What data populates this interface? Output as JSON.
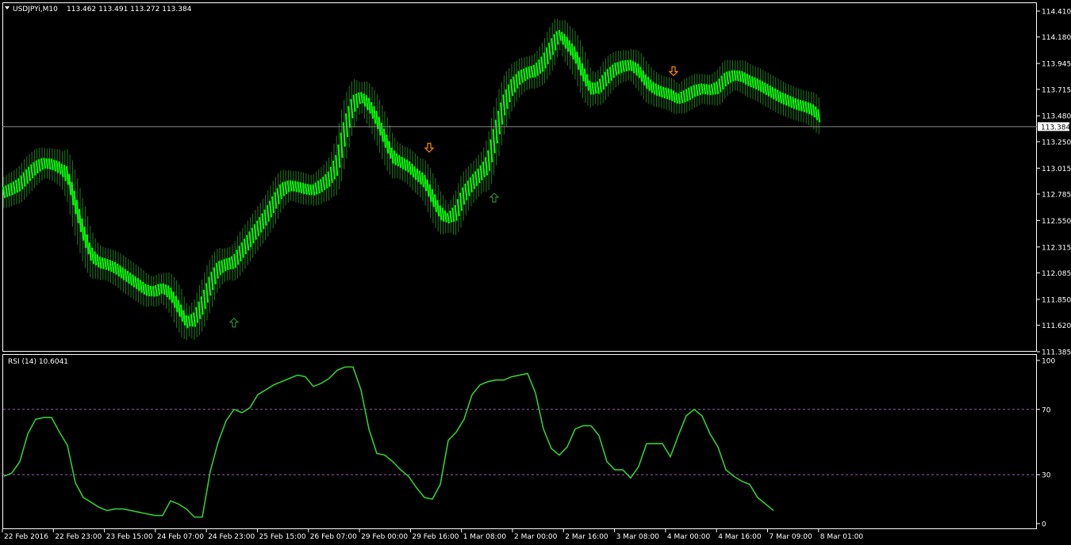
{
  "header": {
    "symbol_label": "USDJPYi,M10",
    "ohlc": "113.462 113.491 113.272 113.384"
  },
  "rsi_header": {
    "label": "RSI (14) 10.6041"
  },
  "colors": {
    "background": "#000000",
    "bars": "#00ff00",
    "bar_outline": "#1c7d1c",
    "rsi_line": "#32cd32",
    "level_line": "#9b59b6",
    "axis": "#ffffff",
    "arrow_up": "#2e8b2e",
    "arrow_down": "#ff8c00"
  },
  "icons": [
    "menu-triangle-icon",
    "up-arrow-icon",
    "down-arrow-icon"
  ],
  "chart_data": [
    {
      "type": "line",
      "name": "price",
      "ylim": [
        111.385,
        114.41
      ],
      "yticks": [
        "114.410",
        "114.180",
        "113.945",
        "113.715",
        "113.480",
        "113.250",
        "113.015",
        "112.785",
        "112.550",
        "112.315",
        "112.085",
        "111.850",
        "111.620",
        "111.385"
      ],
      "current_price": "113.384",
      "current_price_value": 113.384,
      "x": [
        0,
        10,
        20,
        30,
        40,
        50,
        60,
        70,
        80,
        90,
        100,
        110,
        120,
        130,
        140,
        150,
        160,
        170,
        180,
        190,
        200,
        210,
        220,
        230,
        240,
        250,
        260,
        270,
        280,
        290,
        300,
        310,
        320,
        330,
        340,
        350,
        360,
        370,
        380,
        390,
        400,
        410,
        420,
        430,
        440,
        450,
        460,
        470,
        480,
        490,
        500,
        510,
        520,
        530,
        540,
        550,
        560,
        570,
        580,
        590,
        600,
        610,
        620,
        630,
        640,
        650,
        660,
        670,
        680,
        690,
        700,
        710,
        720,
        730,
        740,
        750,
        760,
        770,
        780,
        790,
        800,
        810,
        820,
        830,
        840,
        850,
        860,
        870,
        880,
        890,
        900,
        910,
        920,
        930,
        940,
        950,
        960,
        970,
        980,
        990,
        1000,
        1010,
        1020,
        1030
      ],
      "y": [
        112.8,
        112.83,
        112.87,
        112.95,
        113.02,
        113.06,
        113.05,
        113.02,
        112.95,
        112.7,
        112.45,
        112.25,
        112.18,
        112.16,
        112.13,
        112.08,
        112.03,
        111.98,
        111.93,
        111.92,
        111.95,
        111.9,
        111.78,
        111.65,
        111.67,
        111.8,
        111.98,
        112.12,
        112.16,
        112.18,
        112.28,
        112.38,
        112.48,
        112.58,
        112.7,
        112.82,
        112.86,
        112.85,
        112.83,
        112.82,
        112.86,
        112.92,
        113.05,
        113.35,
        113.58,
        113.65,
        113.58,
        113.45,
        113.28,
        113.12,
        113.07,
        113.03,
        112.96,
        112.9,
        112.76,
        112.62,
        112.57,
        112.62,
        112.78,
        112.88,
        112.96,
        113.05,
        113.32,
        113.57,
        113.73,
        113.82,
        113.86,
        113.88,
        113.95,
        114.08,
        114.2,
        114.12,
        114.02,
        113.86,
        113.72,
        113.73,
        113.82,
        113.89,
        113.92,
        113.93,
        113.88,
        113.78,
        113.72,
        113.69,
        113.67,
        113.63,
        113.66,
        113.7,
        113.72,
        113.71,
        113.73,
        113.81,
        113.84,
        113.83,
        113.79,
        113.76,
        113.72,
        113.68,
        113.64,
        113.61,
        113.58,
        113.56,
        113.53,
        113.46
      ],
      "arrows": [
        {
          "dir": "up",
          "x": 295,
          "price": 111.64
        },
        {
          "dir": "down",
          "x": 541,
          "price": 113.2
        },
        {
          "dir": "up",
          "x": 623,
          "price": 112.75
        },
        {
          "dir": "down",
          "x": 849,
          "price": 113.88
        }
      ]
    },
    {
      "type": "line",
      "name": "RSI (14)",
      "ylim": [
        0,
        100
      ],
      "yticks": [
        "100",
        "70",
        "30",
        "0"
      ],
      "levels": [
        70,
        30
      ],
      "x": [
        0,
        10,
        20,
        30,
        40,
        50,
        60,
        70,
        80,
        90,
        100,
        110,
        120,
        130,
        140,
        150,
        160,
        170,
        180,
        190,
        200,
        210,
        220,
        230,
        240,
        250,
        260,
        270,
        280,
        290,
        300,
        310,
        320,
        330,
        340,
        350,
        360,
        370,
        380,
        390,
        400,
        410,
        420,
        430,
        440,
        450,
        460,
        470,
        480,
        490,
        500,
        510,
        520,
        530,
        540,
        550,
        560,
        570,
        580,
        590,
        600,
        610,
        620,
        630,
        640,
        650,
        660,
        670,
        680,
        690,
        700,
        710,
        720,
        730,
        740,
        750,
        760,
        770,
        780,
        790,
        800,
        810,
        820,
        830,
        840,
        850,
        860,
        870,
        880,
        890,
        900,
        910,
        920,
        930,
        940,
        950,
        960,
        970,
        980,
        990,
        1000,
        1010,
        1020,
        1030
      ],
      "y": [
        29,
        31,
        38,
        55,
        64,
        65,
        65,
        56,
        48,
        25,
        16,
        13,
        10,
        8,
        9,
        9,
        8,
        7,
        6,
        5,
        5,
        14,
        12,
        9,
        4,
        4,
        32,
        50,
        63,
        70,
        68,
        71,
        79,
        82,
        85,
        87,
        89,
        91,
        90,
        84,
        86,
        89,
        94,
        96,
        96,
        82,
        58,
        43,
        42,
        38,
        33,
        29,
        22,
        16,
        15,
        24,
        51,
        56,
        64,
        79,
        85,
        87,
        88,
        88,
        90,
        91,
        92,
        80,
        58,
        46,
        42,
        47,
        58,
        60,
        60,
        54,
        38,
        33,
        33,
        28,
        35,
        49,
        49,
        49,
        41,
        54,
        66,
        70,
        66,
        55,
        47,
        33,
        29,
        26,
        24,
        16,
        12,
        8
      ],
      "x_labels": [
        "22 Feb 2016",
        "22 Feb 23:00",
        "23 Feb 15:00",
        "24 Feb 07:00",
        "24 Feb 23:00",
        "25 Feb 15:00",
        "26 Feb 07:00",
        "29 Feb 00:00",
        "29 Feb 16:00",
        "1 Mar 08:00",
        "2 Mar 00:00",
        "2 Mar 16:00",
        "3 Mar 08:00",
        "4 Mar 00:00",
        "4 Mar 16:00",
        "7 Mar 09:00",
        "8 Mar 01:00"
      ]
    }
  ]
}
